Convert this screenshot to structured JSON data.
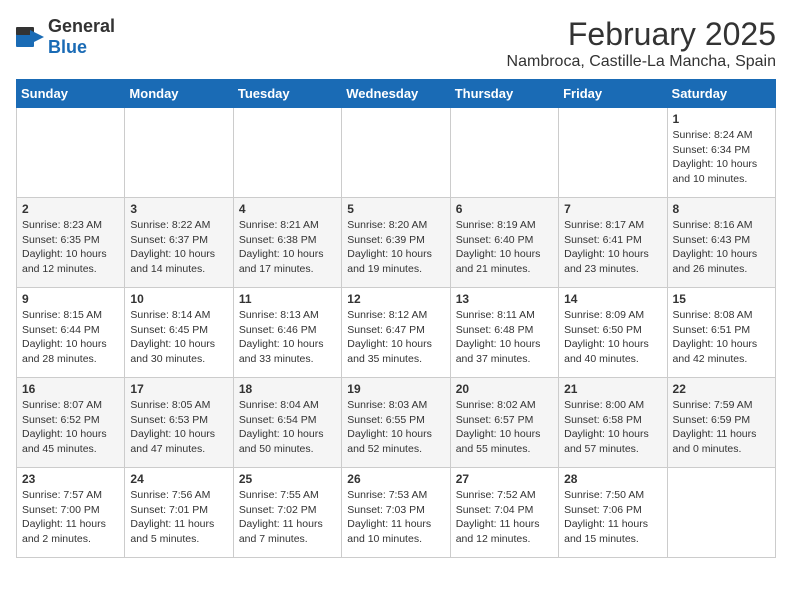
{
  "header": {
    "logo_general": "General",
    "logo_blue": "Blue",
    "title": "February 2025",
    "subtitle": "Nambroca, Castille-La Mancha, Spain"
  },
  "weekdays": [
    "Sunday",
    "Monday",
    "Tuesday",
    "Wednesday",
    "Thursday",
    "Friday",
    "Saturday"
  ],
  "weeks": [
    [
      {
        "day": "",
        "info": ""
      },
      {
        "day": "",
        "info": ""
      },
      {
        "day": "",
        "info": ""
      },
      {
        "day": "",
        "info": ""
      },
      {
        "day": "",
        "info": ""
      },
      {
        "day": "",
        "info": ""
      },
      {
        "day": "1",
        "info": "Sunrise: 8:24 AM\nSunset: 6:34 PM\nDaylight: 10 hours\nand 10 minutes."
      }
    ],
    [
      {
        "day": "2",
        "info": "Sunrise: 8:23 AM\nSunset: 6:35 PM\nDaylight: 10 hours\nand 12 minutes."
      },
      {
        "day": "3",
        "info": "Sunrise: 8:22 AM\nSunset: 6:37 PM\nDaylight: 10 hours\nand 14 minutes."
      },
      {
        "day": "4",
        "info": "Sunrise: 8:21 AM\nSunset: 6:38 PM\nDaylight: 10 hours\nand 17 minutes."
      },
      {
        "day": "5",
        "info": "Sunrise: 8:20 AM\nSunset: 6:39 PM\nDaylight: 10 hours\nand 19 minutes."
      },
      {
        "day": "6",
        "info": "Sunrise: 8:19 AM\nSunset: 6:40 PM\nDaylight: 10 hours\nand 21 minutes."
      },
      {
        "day": "7",
        "info": "Sunrise: 8:17 AM\nSunset: 6:41 PM\nDaylight: 10 hours\nand 23 minutes."
      },
      {
        "day": "8",
        "info": "Sunrise: 8:16 AM\nSunset: 6:43 PM\nDaylight: 10 hours\nand 26 minutes."
      }
    ],
    [
      {
        "day": "9",
        "info": "Sunrise: 8:15 AM\nSunset: 6:44 PM\nDaylight: 10 hours\nand 28 minutes."
      },
      {
        "day": "10",
        "info": "Sunrise: 8:14 AM\nSunset: 6:45 PM\nDaylight: 10 hours\nand 30 minutes."
      },
      {
        "day": "11",
        "info": "Sunrise: 8:13 AM\nSunset: 6:46 PM\nDaylight: 10 hours\nand 33 minutes."
      },
      {
        "day": "12",
        "info": "Sunrise: 8:12 AM\nSunset: 6:47 PM\nDaylight: 10 hours\nand 35 minutes."
      },
      {
        "day": "13",
        "info": "Sunrise: 8:11 AM\nSunset: 6:48 PM\nDaylight: 10 hours\nand 37 minutes."
      },
      {
        "day": "14",
        "info": "Sunrise: 8:09 AM\nSunset: 6:50 PM\nDaylight: 10 hours\nand 40 minutes."
      },
      {
        "day": "15",
        "info": "Sunrise: 8:08 AM\nSunset: 6:51 PM\nDaylight: 10 hours\nand 42 minutes."
      }
    ],
    [
      {
        "day": "16",
        "info": "Sunrise: 8:07 AM\nSunset: 6:52 PM\nDaylight: 10 hours\nand 45 minutes."
      },
      {
        "day": "17",
        "info": "Sunrise: 8:05 AM\nSunset: 6:53 PM\nDaylight: 10 hours\nand 47 minutes."
      },
      {
        "day": "18",
        "info": "Sunrise: 8:04 AM\nSunset: 6:54 PM\nDaylight: 10 hours\nand 50 minutes."
      },
      {
        "day": "19",
        "info": "Sunrise: 8:03 AM\nSunset: 6:55 PM\nDaylight: 10 hours\nand 52 minutes."
      },
      {
        "day": "20",
        "info": "Sunrise: 8:02 AM\nSunset: 6:57 PM\nDaylight: 10 hours\nand 55 minutes."
      },
      {
        "day": "21",
        "info": "Sunrise: 8:00 AM\nSunset: 6:58 PM\nDaylight: 10 hours\nand 57 minutes."
      },
      {
        "day": "22",
        "info": "Sunrise: 7:59 AM\nSunset: 6:59 PM\nDaylight: 11 hours\nand 0 minutes."
      }
    ],
    [
      {
        "day": "23",
        "info": "Sunrise: 7:57 AM\nSunset: 7:00 PM\nDaylight: 11 hours\nand 2 minutes."
      },
      {
        "day": "24",
        "info": "Sunrise: 7:56 AM\nSunset: 7:01 PM\nDaylight: 11 hours\nand 5 minutes."
      },
      {
        "day": "25",
        "info": "Sunrise: 7:55 AM\nSunset: 7:02 PM\nDaylight: 11 hours\nand 7 minutes."
      },
      {
        "day": "26",
        "info": "Sunrise: 7:53 AM\nSunset: 7:03 PM\nDaylight: 11 hours\nand 10 minutes."
      },
      {
        "day": "27",
        "info": "Sunrise: 7:52 AM\nSunset: 7:04 PM\nDaylight: 11 hours\nand 12 minutes."
      },
      {
        "day": "28",
        "info": "Sunrise: 7:50 AM\nSunset: 7:06 PM\nDaylight: 11 hours\nand 15 minutes."
      },
      {
        "day": "",
        "info": ""
      }
    ]
  ]
}
